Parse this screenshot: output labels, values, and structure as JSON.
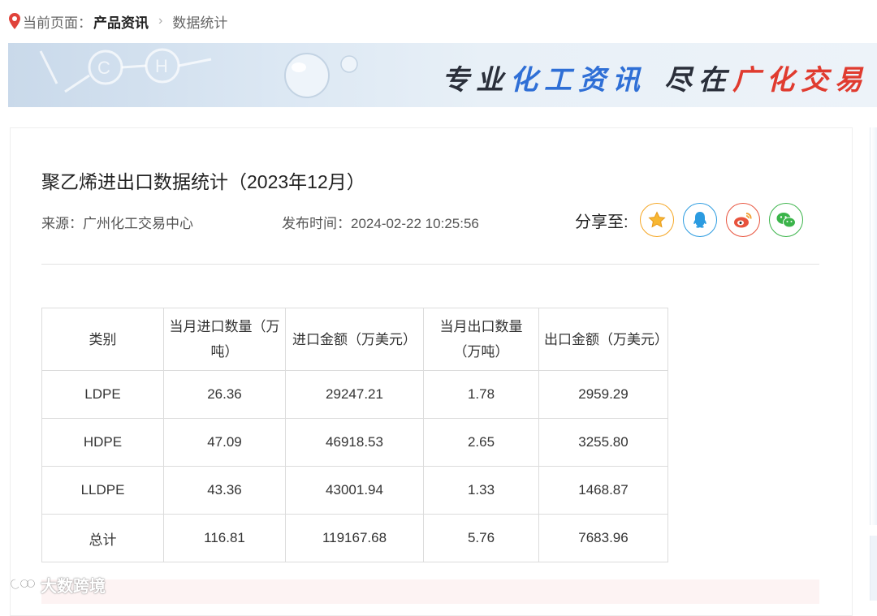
{
  "breadcrumb": {
    "prefix": "当前页面：",
    "current": "产品资讯",
    "separator": "›",
    "last": "数据统计"
  },
  "banner": {
    "slogan_part1": "专业",
    "slogan_part2": "化工资讯",
    "slogan_part3": "尽在",
    "slogan_part4": "广化交易",
    "colors": {
      "dark": "#2a2f3a",
      "blue": "#2f6fd6",
      "red": "#e03b2f"
    }
  },
  "article": {
    "title": "聚乙烯进出口数据统计（2023年12月）",
    "source": "来源：广州化工交易中心",
    "publish_time": "发布时间：2024-02-22 10:25:56"
  },
  "share": {
    "label": "分享至:",
    "buttons": [
      {
        "icon": "star-icon",
        "color": "#f5a623"
      },
      {
        "icon": "qq-icon",
        "color": "#2b9be0"
      },
      {
        "icon": "weibo-icon",
        "color": "#e8533d"
      },
      {
        "icon": "wechat-icon",
        "color": "#3bb44a"
      }
    ]
  },
  "table": {
    "headers": [
      "类别",
      "当月进口数量（万吨）",
      "进口金额（万美元）",
      "当月出口数量（万吨）",
      "出口金额（万美元）"
    ],
    "rows": [
      [
        "LDPE",
        "26.36",
        "29247.21",
        "1.78",
        "2959.29"
      ],
      [
        "HDPE",
        "47.09",
        "46918.53",
        "2.65",
        "3255.80"
      ],
      [
        "LLDPE",
        "43.36",
        "43001.94",
        "1.33",
        "1468.87"
      ],
      [
        "总计",
        "116.81",
        "119167.68",
        "5.76",
        "7683.96"
      ]
    ]
  },
  "watermark": {
    "text": "大数跨境"
  }
}
